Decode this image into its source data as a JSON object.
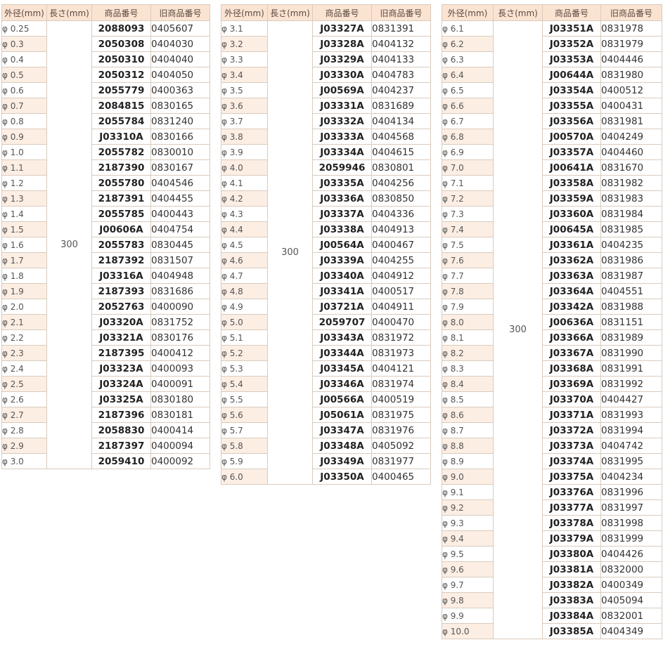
{
  "headers": {
    "diameter": "外径(mm)",
    "length": "長さ(mm)",
    "product_no": "商品番号",
    "old_product_no": "旧商品番号"
  },
  "tables": [
    {
      "length": "300",
      "rows": [
        [
          "φ 0.25",
          "2088093",
          "0405607"
        ],
        [
          "φ 0.3",
          "2050308",
          "0404030"
        ],
        [
          "φ 0.4",
          "2050310",
          "0404040"
        ],
        [
          "φ 0.5",
          "2050312",
          "0404050"
        ],
        [
          "φ 0.6",
          "2055779",
          "0400363"
        ],
        [
          "φ 0.7",
          "2084815",
          "0830165"
        ],
        [
          "φ 0.8",
          "2055784",
          "0831240"
        ],
        [
          "φ 0.9",
          "J03310A",
          "0830166"
        ],
        [
          "φ 1.0",
          "2055782",
          "0830010"
        ],
        [
          "φ 1.1",
          "2187390",
          "0830167"
        ],
        [
          "φ 1.2",
          "2055780",
          "0404546"
        ],
        [
          "φ 1.3",
          "2187391",
          "0404455"
        ],
        [
          "φ 1.4",
          "2055785",
          "0400443"
        ],
        [
          "φ 1.5",
          "J00606A",
          "0404754"
        ],
        [
          "φ 1.6",
          "2055783",
          "0830445"
        ],
        [
          "φ 1.7",
          "2187392",
          "0831507"
        ],
        [
          "φ 1.8",
          "J03316A",
          "0404948"
        ],
        [
          "φ 1.9",
          "2187393",
          "0831686"
        ],
        [
          "φ 2.0",
          "2052763",
          "0400090"
        ],
        [
          "φ 2.1",
          "J03320A",
          "0831752"
        ],
        [
          "φ 2.2",
          "J03321A",
          "0830176"
        ],
        [
          "φ 2.3",
          "2187395",
          "0400412"
        ],
        [
          "φ 2.4",
          "J03323A",
          "0400093"
        ],
        [
          "φ 2.5",
          "J03324A",
          "0400091"
        ],
        [
          "φ 2.6",
          "J03325A",
          "0830180"
        ],
        [
          "φ 2.7",
          "2187396",
          "0830181"
        ],
        [
          "φ 2.8",
          "2058830",
          "0400414"
        ],
        [
          "φ 2.9",
          "2187397",
          "0400094"
        ],
        [
          "φ 3.0",
          "2059410",
          "0400092"
        ]
      ]
    },
    {
      "length": "300",
      "rows": [
        [
          "φ 3.1",
          "J03327A",
          "0831391"
        ],
        [
          "φ 3.2",
          "J03328A",
          "0404132"
        ],
        [
          "φ 3.3",
          "J03329A",
          "0404133"
        ],
        [
          "φ 3.4",
          "J03330A",
          "0404783"
        ],
        [
          "φ 3.5",
          "J00569A",
          "0404237"
        ],
        [
          "φ 3.6",
          "J03331A",
          "0831689"
        ],
        [
          "φ 3.7",
          "J03332A",
          "0404134"
        ],
        [
          "φ 3.8",
          "J03333A",
          "0404568"
        ],
        [
          "φ 3.9",
          "J03334A",
          "0404615"
        ],
        [
          "φ 4.0",
          "2059946",
          "0830801"
        ],
        [
          "φ 4.1",
          "J03335A",
          "0404256"
        ],
        [
          "φ 4.2",
          "J03336A",
          "0830850"
        ],
        [
          "φ 4.3",
          "J03337A",
          "0404336"
        ],
        [
          "φ 4.4",
          "J03338A",
          "0404913"
        ],
        [
          "φ 4.5",
          "J00564A",
          "0400467"
        ],
        [
          "φ 4.6",
          "J03339A",
          "0404255"
        ],
        [
          "φ 4.7",
          "J03340A",
          "0404912"
        ],
        [
          "φ 4.8",
          "J03341A",
          "0400517"
        ],
        [
          "φ 4.9",
          "J03721A",
          "0404911"
        ],
        [
          "φ 5.0",
          "2059707",
          "0400470"
        ],
        [
          "φ 5.1",
          "J03343A",
          "0831972"
        ],
        [
          "φ 5.2",
          "J03344A",
          "0831973"
        ],
        [
          "φ 5.3",
          "J03345A",
          "0404121"
        ],
        [
          "φ 5.4",
          "J03346A",
          "0831974"
        ],
        [
          "φ 5.5",
          "J00566A",
          "0400519"
        ],
        [
          "φ 5.6",
          "J05061A",
          "0831975"
        ],
        [
          "φ 5.7",
          "J03347A",
          "0831976"
        ],
        [
          "φ 5.8",
          "J03348A",
          "0405092"
        ],
        [
          "φ 5.9",
          "J03349A",
          "0831977"
        ],
        [
          "φ 6.0",
          "J03350A",
          "0400465"
        ]
      ]
    },
    {
      "length": "300",
      "rows": [
        [
          "φ 6.1",
          "J03351A",
          "0831978"
        ],
        [
          "φ 6.2",
          "J03352A",
          "0831979"
        ],
        [
          "φ 6.3",
          "J03353A",
          "0404446"
        ],
        [
          "φ 6.4",
          "J00644A",
          "0831980"
        ],
        [
          "φ 6.5",
          "J03354A",
          "0400512"
        ],
        [
          "φ 6.6",
          "J03355A",
          "0400431"
        ],
        [
          "φ 6.7",
          "J03356A",
          "0831981"
        ],
        [
          "φ 6.8",
          "J00570A",
          "0404249"
        ],
        [
          "φ 6.9",
          "J03357A",
          "0404460"
        ],
        [
          "φ 7.0",
          "J00641A",
          "0831670"
        ],
        [
          "φ 7.1",
          "J03358A",
          "0831982"
        ],
        [
          "φ 7.2",
          "J03359A",
          "0831983"
        ],
        [
          "φ 7.3",
          "J03360A",
          "0831984"
        ],
        [
          "φ 7.4",
          "J00645A",
          "0831985"
        ],
        [
          "φ 7.5",
          "J03361A",
          "0404235"
        ],
        [
          "φ 7.6",
          "J03362A",
          "0831986"
        ],
        [
          "φ 7.7",
          "J03363A",
          "0831987"
        ],
        [
          "φ 7.8",
          "J03364A",
          "0404551"
        ],
        [
          "φ 7.9",
          "J03342A",
          "0831988"
        ],
        [
          "φ 8.0",
          "J00636A",
          "0831151"
        ],
        [
          "φ 8.1",
          "J03366A",
          "0831989"
        ],
        [
          "φ 8.2",
          "J03367A",
          "0831990"
        ],
        [
          "φ 8.3",
          "J03368A",
          "0831991"
        ],
        [
          "φ 8.4",
          "J03369A",
          "0831992"
        ],
        [
          "φ 8.5",
          "J03370A",
          "0404427"
        ],
        [
          "φ 8.6",
          "J03371A",
          "0831993"
        ],
        [
          "φ 8.7",
          "J03372A",
          "0831994"
        ],
        [
          "φ 8.8",
          "J03373A",
          "0404742"
        ],
        [
          "φ 8.9",
          "J03374A",
          "0831995"
        ],
        [
          "φ 9.0",
          "J03375A",
          "0404234"
        ],
        [
          "φ 9.1",
          "J03376A",
          "0831996"
        ],
        [
          "φ 9.2",
          "J03377A",
          "0831997"
        ],
        [
          "φ 9.3",
          "J03378A",
          "0831998"
        ],
        [
          "φ 9.4",
          "J03379A",
          "0831999"
        ],
        [
          "φ 9.5",
          "J03380A",
          "0404426"
        ],
        [
          "φ 9.6",
          "J03381A",
          "0832000"
        ],
        [
          "φ 9.7",
          "J03382A",
          "0400349"
        ],
        [
          "φ 9.8",
          "J03383A",
          "0405094"
        ],
        [
          "φ 9.9",
          "J03384A",
          "0832001"
        ],
        [
          "φ 10.0",
          "J03385A",
          "0404349"
        ]
      ]
    }
  ]
}
